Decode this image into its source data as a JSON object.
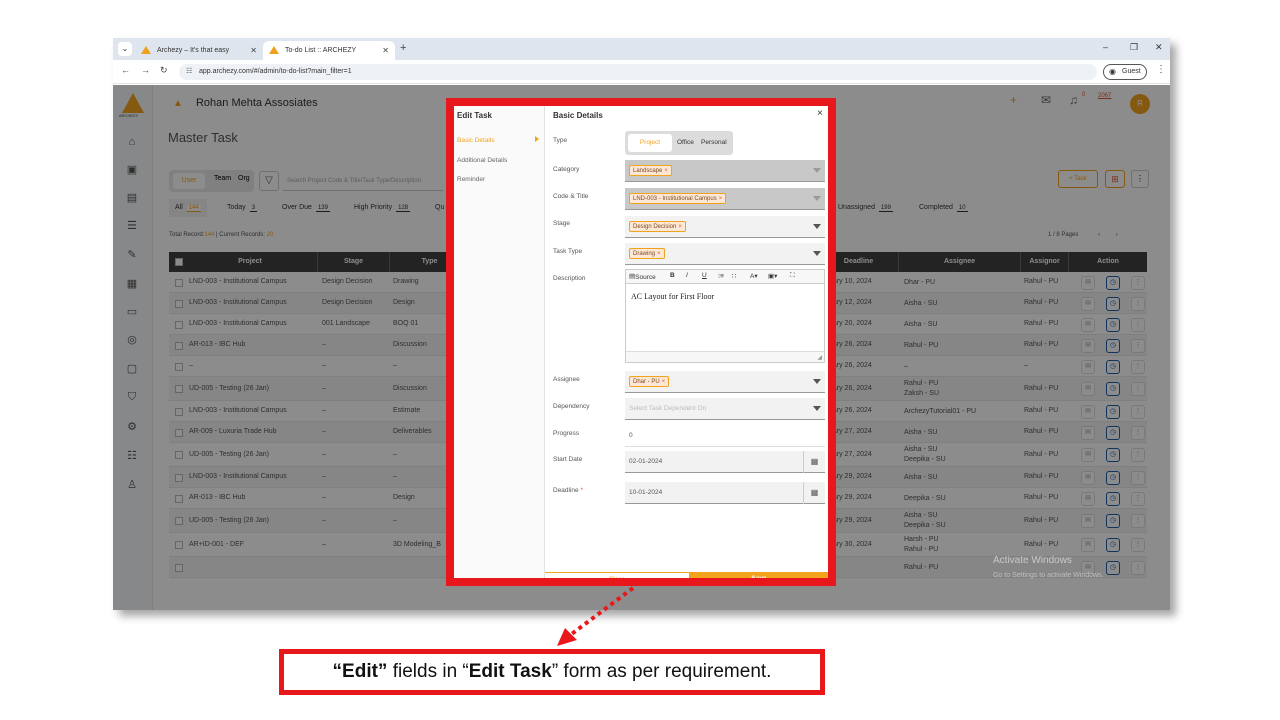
{
  "browser": {
    "tabs": [
      {
        "title": "Archezy – It's that easy"
      },
      {
        "title": "To-do List :: ARCHEZY"
      }
    ],
    "url": "app.archezy.com/#/admin/to-do-list?main_filter=1",
    "guest_label": "Guest"
  },
  "app": {
    "brand_text": "ARCHEZY",
    "company": "Rohan Mehta Assosiates",
    "page_title": "Master Task",
    "notification_count": "0",
    "points": "2067",
    "avatar_initial": "R",
    "scope": {
      "options": [
        "User",
        "Team",
        "Org"
      ],
      "selected": "User"
    },
    "search_placeholder": "Search Project Code & Title/Task Type/Description",
    "filters": [
      {
        "label": "All",
        "count": "144",
        "active": true
      },
      {
        "label": "Today",
        "count": "3"
      },
      {
        "label": "Over Due",
        "count": "139"
      },
      {
        "label": "High Priority",
        "count": "128"
      },
      {
        "label": "Qu"
      },
      {
        "label": "Unassigned",
        "count": "199"
      },
      {
        "label": "Completed",
        "count": "10"
      }
    ],
    "total_label": "Total Record:",
    "total_value": "144",
    "current_label": " | Current Records: ",
    "current_value": "20",
    "pagination": "1 / 8 Pages",
    "add_task_label": "+ Task",
    "columns": [
      "Project",
      "Stage",
      "Type",
      "Deadline",
      "Assignee",
      "Assignor",
      "Action"
    ],
    "rows": [
      {
        "project": "LND-003 - Institutional Campus",
        "stage": "Design Decision",
        "type": "Drawing",
        "deadline": "uary 10, 2024",
        "assignees": [
          "Dhar - PU"
        ],
        "assignor": "Rahul - PU"
      },
      {
        "project": "LND-003 - Institutional Campus",
        "stage": "Design Decision",
        "type": "Design",
        "deadline": "uary 12, 2024",
        "assignees": [
          "Aisha - SU"
        ],
        "assignor": "Rahul - PU"
      },
      {
        "project": "LND-003 - Institutional Campus",
        "stage": "001 Landscape",
        "type": "BOQ 01",
        "deadline": "uary 20, 2024",
        "assignees": [
          "Aisha - SU"
        ],
        "assignor": "Rahul - PU"
      },
      {
        "project": "AR-013 - IBC Hub",
        "stage": "–",
        "type": "Discussion",
        "deadline": "uary 26, 2024",
        "assignees": [
          "Rahul - PU"
        ],
        "assignor": "Rahul - PU"
      },
      {
        "project": "–",
        "stage": "–",
        "type": "–",
        "deadline": "uary 26, 2024",
        "assignees": [
          "–"
        ],
        "assignor": "–"
      },
      {
        "project": "UD-005 - Testing (26 Jan)",
        "stage": "–",
        "type": "Discussion",
        "deadline": "uary 26, 2024",
        "assignees": [
          "Rahul - PU",
          "Zaksh - SU"
        ],
        "assignor": "Rahul - PU"
      },
      {
        "project": "LND-003 - Institutional Campus",
        "stage": "–",
        "type": "Estimate",
        "deadline": "uary 26, 2024",
        "assignees": [
          "ArchezyTutorial01 - PU"
        ],
        "assignor": "Rahul - PU"
      },
      {
        "project": "AR-009 - Luxuria Trade Hub",
        "stage": "–",
        "type": "Deliverables",
        "deadline": "uary 27, 2024",
        "assignees": [
          "Aisha - SU"
        ],
        "assignor": "Rahul - PU"
      },
      {
        "project": "UD-005 - Testing (26 Jan)",
        "stage": "–",
        "type": "–",
        "deadline": "uary 27, 2024",
        "assignees": [
          "Aisha - SU",
          "Deepika - SU"
        ],
        "assignor": "Rahul - PU"
      },
      {
        "project": "LND-003 - Institutional Campus",
        "stage": "–",
        "type": "–",
        "deadline": "uary 29, 2024",
        "assignees": [
          "Aisha - SU"
        ],
        "assignor": "Rahul - PU"
      },
      {
        "project": "AR-013 - IBC Hub",
        "stage": "–",
        "type": "Design",
        "deadline": "uary 29, 2024",
        "assignees": [
          "Deepika - SU"
        ],
        "assignor": "Rahul - PU"
      },
      {
        "project": "UD-005 - Testing (26 Jan)",
        "stage": "–",
        "type": "–",
        "deadline": "uary 29, 2024",
        "assignees": [
          "Aisha - SU",
          "Deepika - SU"
        ],
        "assignor": "Rahul - PU"
      },
      {
        "project": "AR+ID-001 - DEF",
        "stage": "–",
        "type": "3D Modeling_B",
        "deadline": "uary 30, 2024",
        "assignees": [
          "Harsh - PU",
          "Rahul - PU"
        ],
        "assignor": "Rahul - PU"
      },
      {
        "project": "",
        "stage": "",
        "type": "",
        "deadline": "",
        "assignees": [
          "Rahul - PU"
        ],
        "assignor": ""
      }
    ],
    "watermark_title": "Activate Windows",
    "watermark_sub": "Go to Settings to activate Windows."
  },
  "modal": {
    "title": "Edit Task",
    "nav": [
      "Basic Details",
      "Additional Details",
      "Reminder"
    ],
    "section_title": "Basic Details",
    "close_icon": "×",
    "type_label": "Type",
    "type_options": [
      "Project",
      "Office",
      "Personal"
    ],
    "category_label": "Category",
    "category_value": "Landscape",
    "code_label": "Code & Title",
    "code_value": "LND-003 - Institutional Campus",
    "stage_label": "Stage",
    "stage_value": "Design Decision",
    "task_type_label": "Task Type",
    "task_type_value": "Drawing",
    "description_label": "Description",
    "editor_toolbar": {
      "source": "Source",
      "bold": "B",
      "italic": "I",
      "underline": "U"
    },
    "description_value": "AC Layout for First Floor",
    "assignee_label": "Assignee",
    "assignee_value": "Dhar - PU",
    "dependency_label": "Dependency",
    "dependency_placeholder": "Select Task Dependent On",
    "progress_label": "Progress",
    "progress_value": "0",
    "start_date_label": "Start Date",
    "start_date_value": "02-01-2024",
    "deadline_label": "Deadline",
    "deadline_value": "10-01-2024",
    "close_button": "Close",
    "save_button": "Save"
  },
  "callout": {
    "part1": "“Edit”",
    "part2": " fields in “",
    "part3": "Edit Task",
    "part4": "” form as per requirement."
  },
  "colors": {
    "accent": "#f2a31c",
    "highlight_border": "#e8171b",
    "header_dark": "#414141"
  }
}
